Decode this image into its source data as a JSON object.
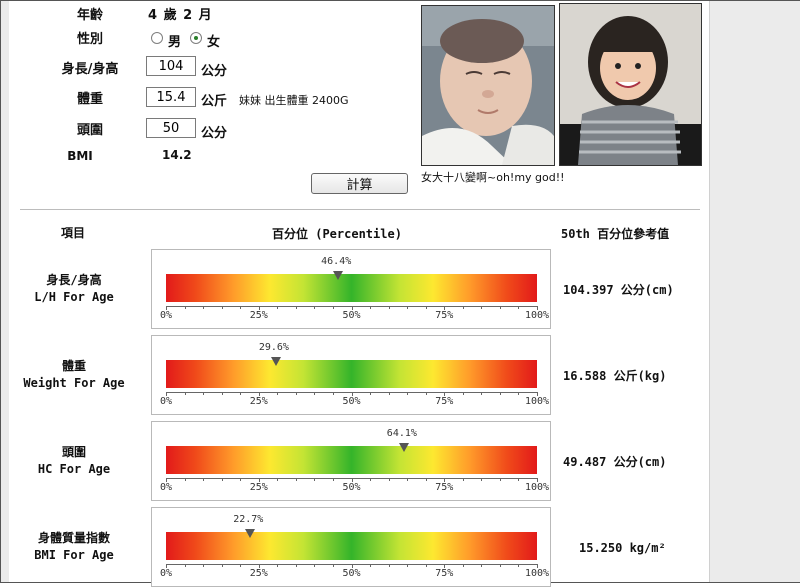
{
  "form": {
    "age_label": "年齡",
    "age_value": "4 歲 2 月",
    "gender_label": "性別",
    "gender_options": [
      "男",
      "女"
    ],
    "gender_selected": "女",
    "height_label": "身長/身高",
    "height_value": "104",
    "height_unit": "公分",
    "weight_label": "體重",
    "weight_value": "15.4",
    "weight_unit": "公斤",
    "weight_note": "妹妹 出生體重 2400G",
    "hc_label": "頭圍",
    "hc_value": "50",
    "hc_unit": "公分",
    "bmi_label": "BMI",
    "bmi_value": "14.2",
    "calculate_button": "計算"
  },
  "photos": {
    "caption": "女大十八變啊~oh!my god!!"
  },
  "table": {
    "col_item": "項目",
    "col_percentile": "百分位 (Percentile)",
    "col_reference": "50th 百分位參考值"
  },
  "scale_ticks": [
    "0%",
    "25%",
    "50%",
    "75%",
    "100%"
  ],
  "rows": [
    {
      "name_zh": "身長/身高",
      "name_en": "L/H For Age",
      "percentile": 46.4,
      "percentile_label": "46.4%",
      "reference": "104.397 公分(cm)"
    },
    {
      "name_zh": "體重",
      "name_en": "Weight For Age",
      "percentile": 29.6,
      "percentile_label": "29.6%",
      "reference": "16.588  公斤(kg)"
    },
    {
      "name_zh": "頭圍",
      "name_en": "HC For Age",
      "percentile": 64.1,
      "percentile_label": "64.1%",
      "reference": "49.487  公分(cm)"
    },
    {
      "name_zh": "身體質量指數",
      "name_en": "BMI For Age",
      "percentile": 22.7,
      "percentile_label": "22.7%",
      "reference": "15.250  kg/m²"
    }
  ],
  "colors": {
    "bar_low": "#e21a1a",
    "bar_mid": "#34b42a",
    "marker": "#555555",
    "radio_selected": "#2a7f2a"
  }
}
